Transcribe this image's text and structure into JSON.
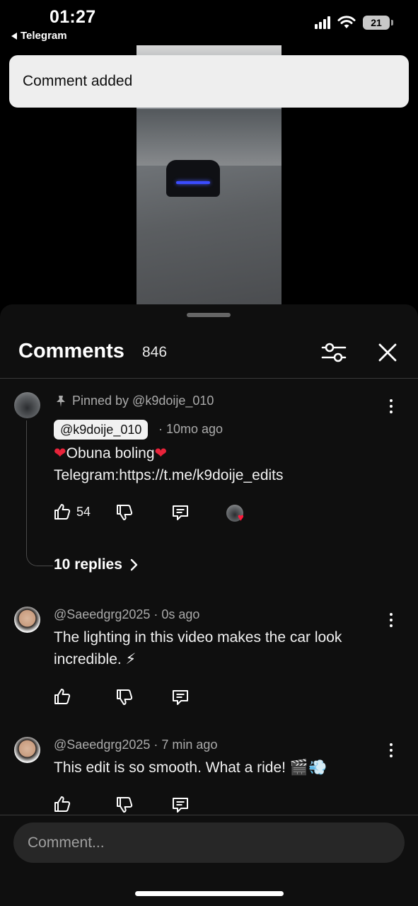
{
  "status_bar": {
    "time": "01:27",
    "back_app": "Telegram",
    "battery": "21"
  },
  "toast": {
    "message": "Comment added"
  },
  "comments_panel": {
    "title": "Comments",
    "count": "846",
    "pinned_comment": {
      "pinned_by": "Pinned by @k9doije_010",
      "author": "@k9doije_010",
      "time": "· 10mo ago",
      "line1_text": "Obuna boling",
      "line2_text": "Telegram:https://t.me/k9doije_edits",
      "like_count": "54",
      "replies": "10 replies"
    },
    "comments": [
      {
        "author": "@Saeedgrg2025",
        "time": "· 0s ago",
        "line1": "The lighting in this video makes the car look",
        "line2": "incredible. ⚡"
      },
      {
        "author": "@Saeedgrg2025",
        "time": "· 7 min ago",
        "line1": "This edit is so smooth. What a ride! 🎬💨"
      }
    ]
  },
  "input": {
    "placeholder": "Comment..."
  },
  "colors": {
    "sheet_bg": "#0f0f0f",
    "toast_bg": "#eeeeee",
    "heart": "#e8233a",
    "input_bg": "#272727"
  }
}
